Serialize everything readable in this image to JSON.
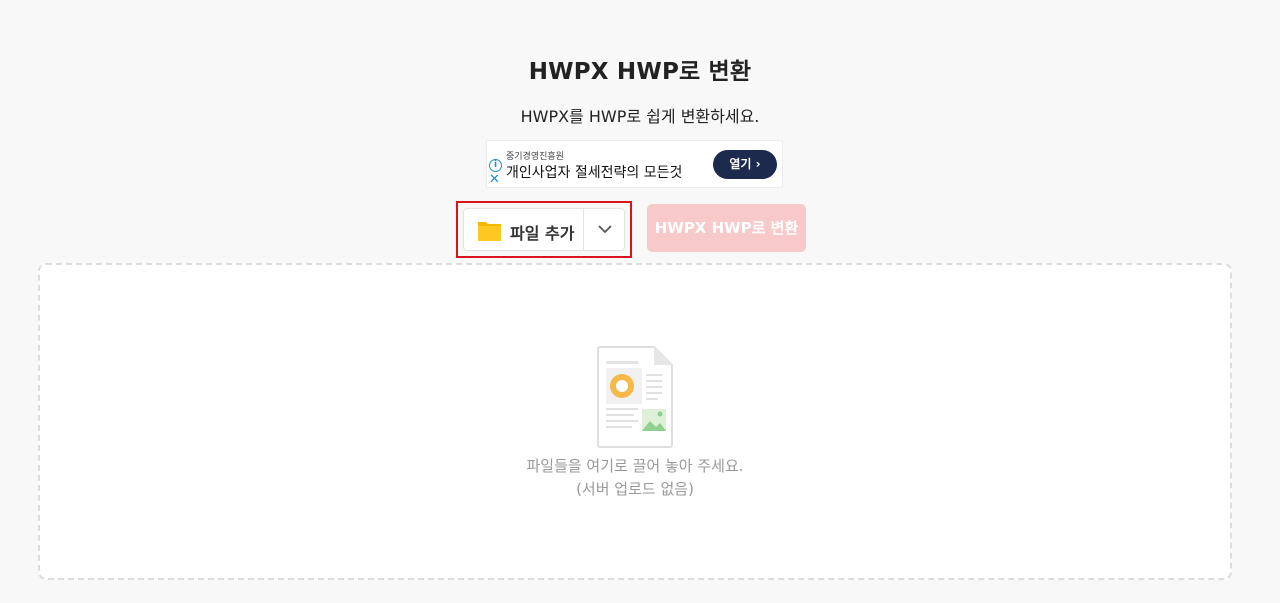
{
  "page": {
    "title": "HWPX HWP로 변환",
    "subtitle": "HWPX를 HWP로 쉽게 변환하세요."
  },
  "ad": {
    "sponsor": "중기경영진흥원",
    "headline": "개인사업자 절세전략의 모든것",
    "open_label": "열기 ›",
    "info_icon": "info-icon",
    "close_icon": "close-icon"
  },
  "toolbar": {
    "add_file_label": "파일 추가",
    "folder_icon": "folder-icon",
    "dropdown_icon": "chevron-down-icon",
    "convert_label": "HWPX HWP로 변환",
    "convert_color": "#f7c9c9",
    "highlight_color": "#d9141f"
  },
  "dropzone": {
    "line1": "파일들을 여기로 끌어 놓아 주세요.",
    "line2": "(서버 업로드 없음)",
    "icon": "document-icon"
  }
}
